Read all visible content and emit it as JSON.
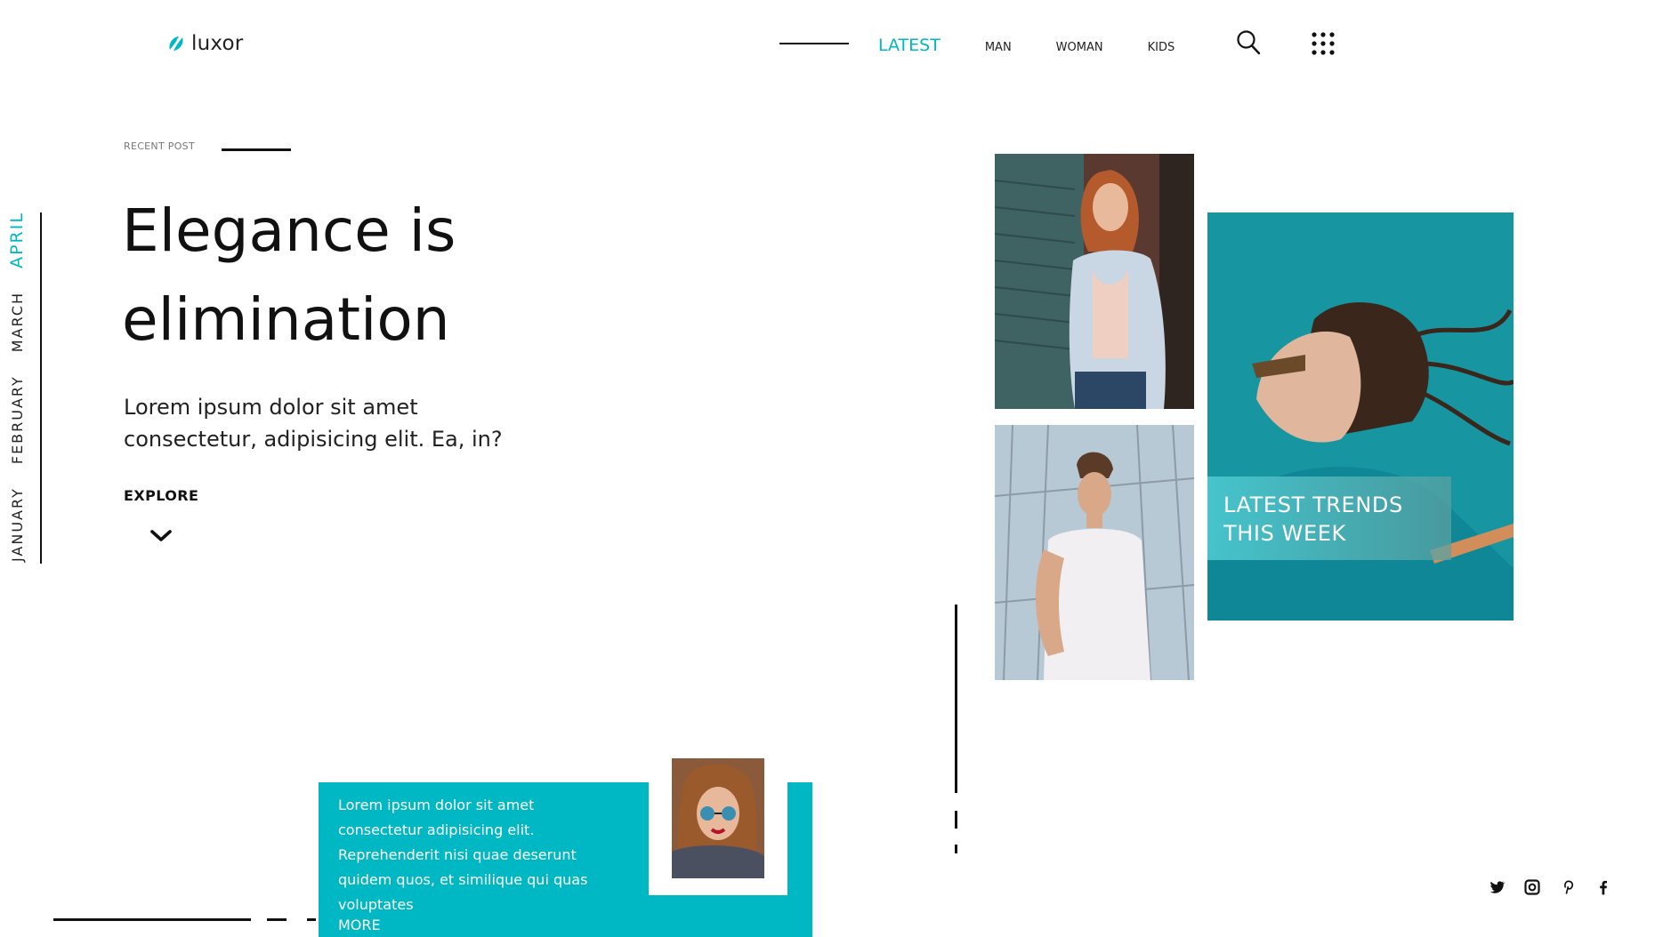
{
  "brand": {
    "name": "luxor",
    "accent": "#00b7c4"
  },
  "nav": {
    "items": [
      {
        "label": "LATEST",
        "active": true
      },
      {
        "label": "MAN",
        "active": false
      },
      {
        "label": "WOMAN",
        "active": false
      },
      {
        "label": "KIDS",
        "active": false
      }
    ],
    "icons": [
      "search-icon",
      "grid-menu-icon"
    ]
  },
  "months": [
    {
      "label": "JANUARY",
      "active": false
    },
    {
      "label": "FEBRUARY",
      "active": false
    },
    {
      "label": "MARCH",
      "active": false
    },
    {
      "label": "APRIL",
      "active": true
    }
  ],
  "hero": {
    "eyebrow": "RECENT POST",
    "title": "Elegance is elimination",
    "description": "Lorem ipsum dolor sit amet consectetur, adipisicing elit. Ea, in?",
    "cta": "EXPLORE"
  },
  "feature": {
    "caption_line1": "LATEST TRENDS",
    "caption_line2": "THIS WEEK"
  },
  "teaser": {
    "text": "Lorem ipsum dolor sit amet consectetur adipisicing elit. Reprehenderit nisi quae deserunt quidem quos, et similique qui quas voluptates",
    "more": "MORE"
  },
  "social": [
    "twitter-icon",
    "instagram-icon",
    "pinterest-icon",
    "facebook-icon"
  ]
}
